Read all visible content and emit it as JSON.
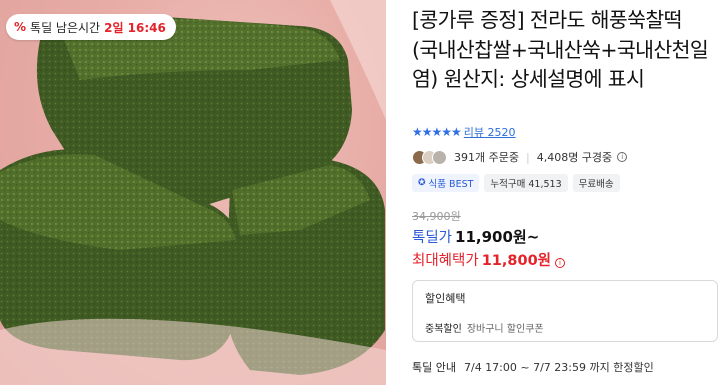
{
  "badge": {
    "percent_icon": "%",
    "label": "톡딜 남은시간",
    "remaining": "2일 16:46"
  },
  "product": {
    "title": "[콩가루 증정] 전라도 해풍쑥찰떡 (국내산찹쌀+국내산쑥+국내산천일염) 원산지: 상세설명에 표시",
    "stars": "★★★★★",
    "review_label": "리뷰",
    "review_count": "2520",
    "orders": "391개 주문중",
    "watching": "4,408명 구경중",
    "tags": {
      "best": "식품 BEST",
      "cumulative": "누적구매 41,513",
      "shipping": "무료배송"
    },
    "original_price": "34,900원",
    "deal_label": "톡딜가",
    "deal_price": "11,900원~",
    "max_label": "최대혜택가",
    "max_price": "11,800원"
  },
  "coupon": {
    "title": "할인혜택",
    "dup_label": "중복할인",
    "dup_value": "장바구니 할인쿠폰"
  },
  "deal_info": {
    "label": "톡딜 안내",
    "period": "7/4 17:00 ~ 7/7 23:59 까지 한정할인"
  }
}
